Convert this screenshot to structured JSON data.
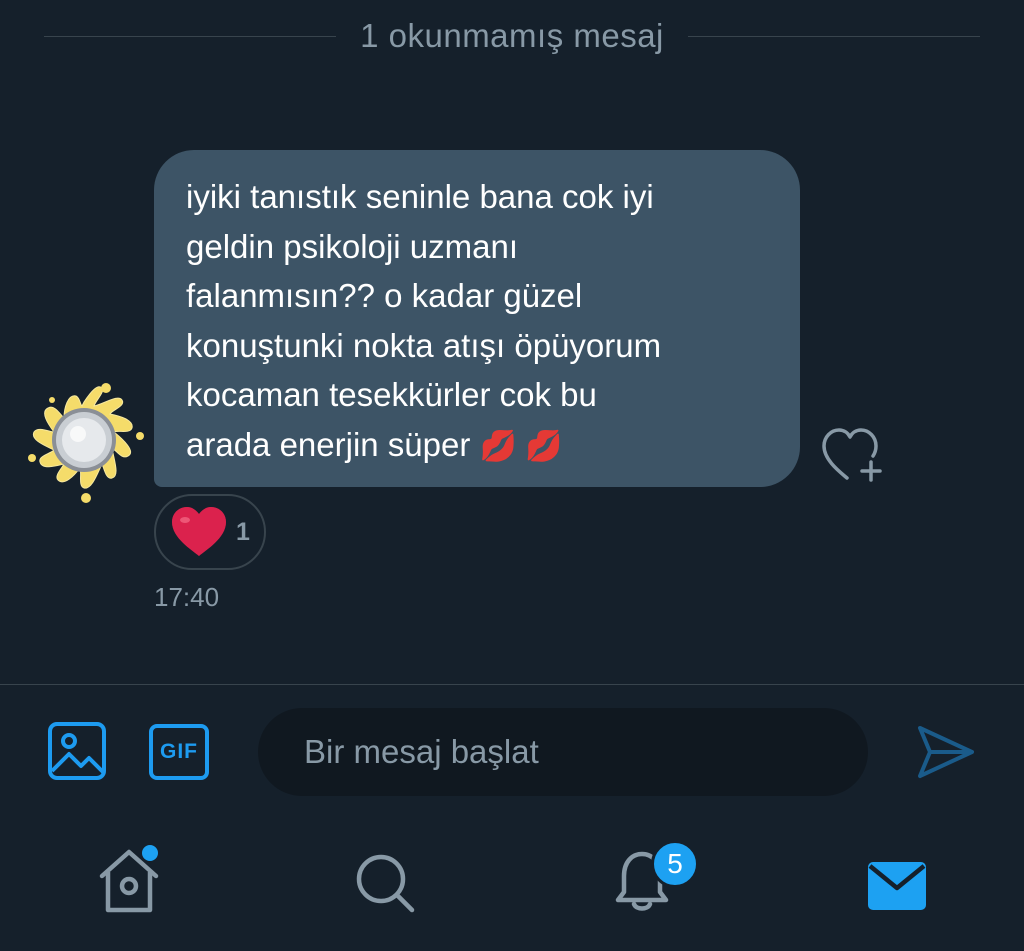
{
  "unread_divider": {
    "text": "1 okunmamış mesaj"
  },
  "message": {
    "text": "iyiki tanıstık seninle bana cok iyi\ngeldin psikoloji uzmanı\nfalanmısın?? o kadar güzel\nkonuştunki nokta atışı öpüyorum\nkocaman tesekkürler cok bu\narada enerjin süper ",
    "emoji": "💋 💋",
    "timestamp": "17:40",
    "reaction": {
      "icon": "heart-icon",
      "count": "1"
    }
  },
  "composer": {
    "placeholder": "Bir mesaj başlat",
    "media_icon": "image-icon",
    "gif_label": "GIF",
    "send_icon": "send-icon"
  },
  "nav": {
    "items": [
      {
        "name": "home",
        "icon": "home-icon"
      },
      {
        "name": "search",
        "icon": "search-icon"
      },
      {
        "name": "notifications",
        "icon": "bell-icon"
      },
      {
        "name": "messages",
        "icon": "mail-icon"
      }
    ],
    "notifications_badge": "5"
  },
  "colors": {
    "background": "#15202b",
    "bubble": "#3d5466",
    "accent": "#1da1f2",
    "secondary_text": "#8899a6",
    "divider": "#38444d",
    "reaction_heart": "#e0245e"
  }
}
